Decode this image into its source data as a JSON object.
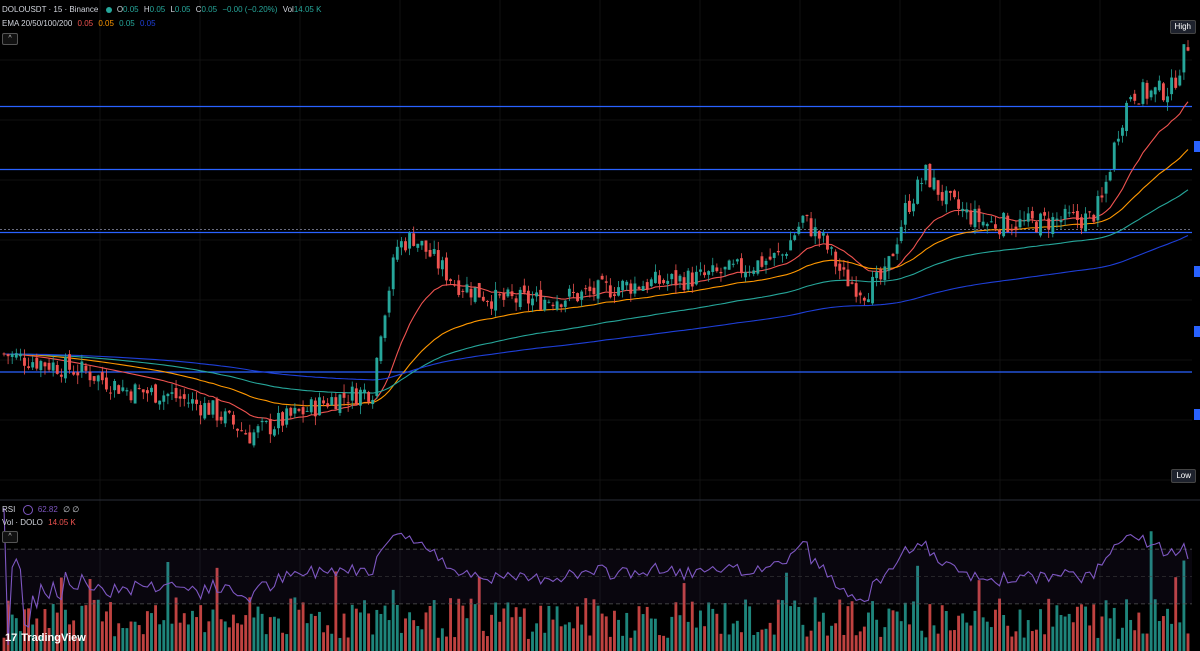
{
  "legend": {
    "symbol": "DOLOUSDT · 15 · Binance",
    "o_label": "O",
    "o_value": "0.05",
    "h_label": "H",
    "h_value": "0.05",
    "l_label": "L",
    "l_value": "0.05",
    "c_label": "C",
    "c_value": "0.05",
    "change": "−0.00 (−0.20%)",
    "vol_label": "Vol",
    "vol_value": "14.05 K",
    "ema_label": "EMA 20/50/100/200",
    "ema_values": [
      "0.05",
      "0.05",
      "0.05",
      "0.05"
    ],
    "rsi_label": "RSI",
    "rsi_value": "62.82",
    "rsi_extra": "∅ ∅",
    "vol_indicator_label": "Vol · DOLO",
    "vol_indicator_value": "14.05 K",
    "collapse_glyph": "^"
  },
  "price_tags": {
    "high": "High",
    "low": "Low"
  },
  "brand": {
    "logo_glyph": "17",
    "name": "TradingView"
  },
  "colors": {
    "background": "#000000",
    "up": "#26a69a",
    "down": "#ef5350",
    "ema20": "#ef5350",
    "ema50": "#ff9800",
    "ema100": "#26a69a",
    "ema200": "#1e3fd8",
    "rsi": "#7e57c2",
    "hline": "#2962ff"
  },
  "chart_data": {
    "type": "candlestick",
    "series_count": 290,
    "price_path_norm": [
      [
        0,
        0.28
      ],
      [
        10,
        0.26
      ],
      [
        20,
        0.24
      ],
      [
        30,
        0.2
      ],
      [
        40,
        0.19
      ],
      [
        50,
        0.16
      ],
      [
        60,
        0.1
      ],
      [
        70,
        0.14
      ],
      [
        80,
        0.18
      ],
      [
        90,
        0.2
      ],
      [
        92,
        0.34
      ],
      [
        96,
        0.52
      ],
      [
        100,
        0.54
      ],
      [
        104,
        0.5
      ],
      [
        110,
        0.44
      ],
      [
        120,
        0.4
      ],
      [
        130,
        0.4
      ],
      [
        140,
        0.41
      ],
      [
        150,
        0.43
      ],
      [
        160,
        0.44
      ],
      [
        170,
        0.45
      ],
      [
        180,
        0.47
      ],
      [
        190,
        0.5
      ],
      [
        195,
        0.58
      ],
      [
        200,
        0.53
      ],
      [
        205,
        0.45
      ],
      [
        210,
        0.42
      ],
      [
        215,
        0.45
      ],
      [
        220,
        0.6
      ],
      [
        225,
        0.68
      ],
      [
        230,
        0.62
      ],
      [
        235,
        0.59
      ],
      [
        240,
        0.57
      ],
      [
        250,
        0.57
      ],
      [
        260,
        0.58
      ],
      [
        265,
        0.58
      ],
      [
        268,
        0.62
      ],
      [
        272,
        0.78
      ],
      [
        275,
        0.86
      ],
      [
        280,
        0.86
      ],
      [
        285,
        0.87
      ],
      [
        289,
        0.97
      ]
    ],
    "horizontal_levels_norm": [
      0.24,
      0.55,
      0.69,
      0.83
    ],
    "rsi_overbought": 70,
    "rsi_oversold": 30,
    "last_rsi": 62.82
  }
}
